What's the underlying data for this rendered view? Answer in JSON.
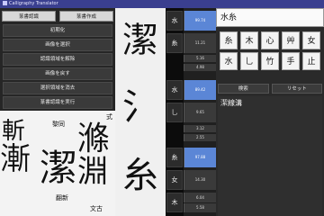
{
  "window": {
    "title": "Calligraphy Translator"
  },
  "mode_tabs": [
    "篆書認識",
    "篆書作成"
  ],
  "commands": [
    "初期化",
    "画像を選択",
    "認識領域を解除",
    "画像を戻す",
    "選択領域を消去",
    "篆書認識を実行"
  ],
  "preview": {
    "labels": [
      "黎同",
      "式",
      "翻新",
      "文古"
    ],
    "glyphs": [
      "斬",
      "漸",
      "潔",
      "淵",
      "滌"
    ]
  },
  "big_glyphs": [
    "潔",
    "氵",
    "糸"
  ],
  "parts": [
    {
      "label": "水",
      "value": "99.74",
      "active": true
    },
    {
      "label": "糸",
      "value": "11.21",
      "active": false
    },
    {
      "label": "",
      "value": "5.16",
      "active": false
    },
    {
      "label": "",
      "value": "4.98",
      "active": false
    },
    {
      "label": "水",
      "value": "89.42",
      "active": true
    },
    {
      "label": "乚",
      "value": "9.65",
      "active": false
    },
    {
      "label": "",
      "value": "3.12",
      "active": false
    },
    {
      "label": "",
      "value": "2.55",
      "active": false
    },
    {
      "label": "糸",
      "value": "97.88",
      "active": true
    },
    {
      "label": "女",
      "value": "14.30",
      "active": false
    },
    {
      "label": "木",
      "value": "6.04",
      "active": false
    },
    {
      "label": "",
      "value": "5.58",
      "active": false
    }
  ],
  "right": {
    "radical_field": "水糸",
    "radicals": [
      "糸",
      "木",
      "心",
      "艸",
      "女",
      "水",
      "乚",
      "竹",
      "手",
      "⽌"
    ],
    "search_label": "検索",
    "reset_label": "リセット",
    "result": "潔線溝"
  }
}
